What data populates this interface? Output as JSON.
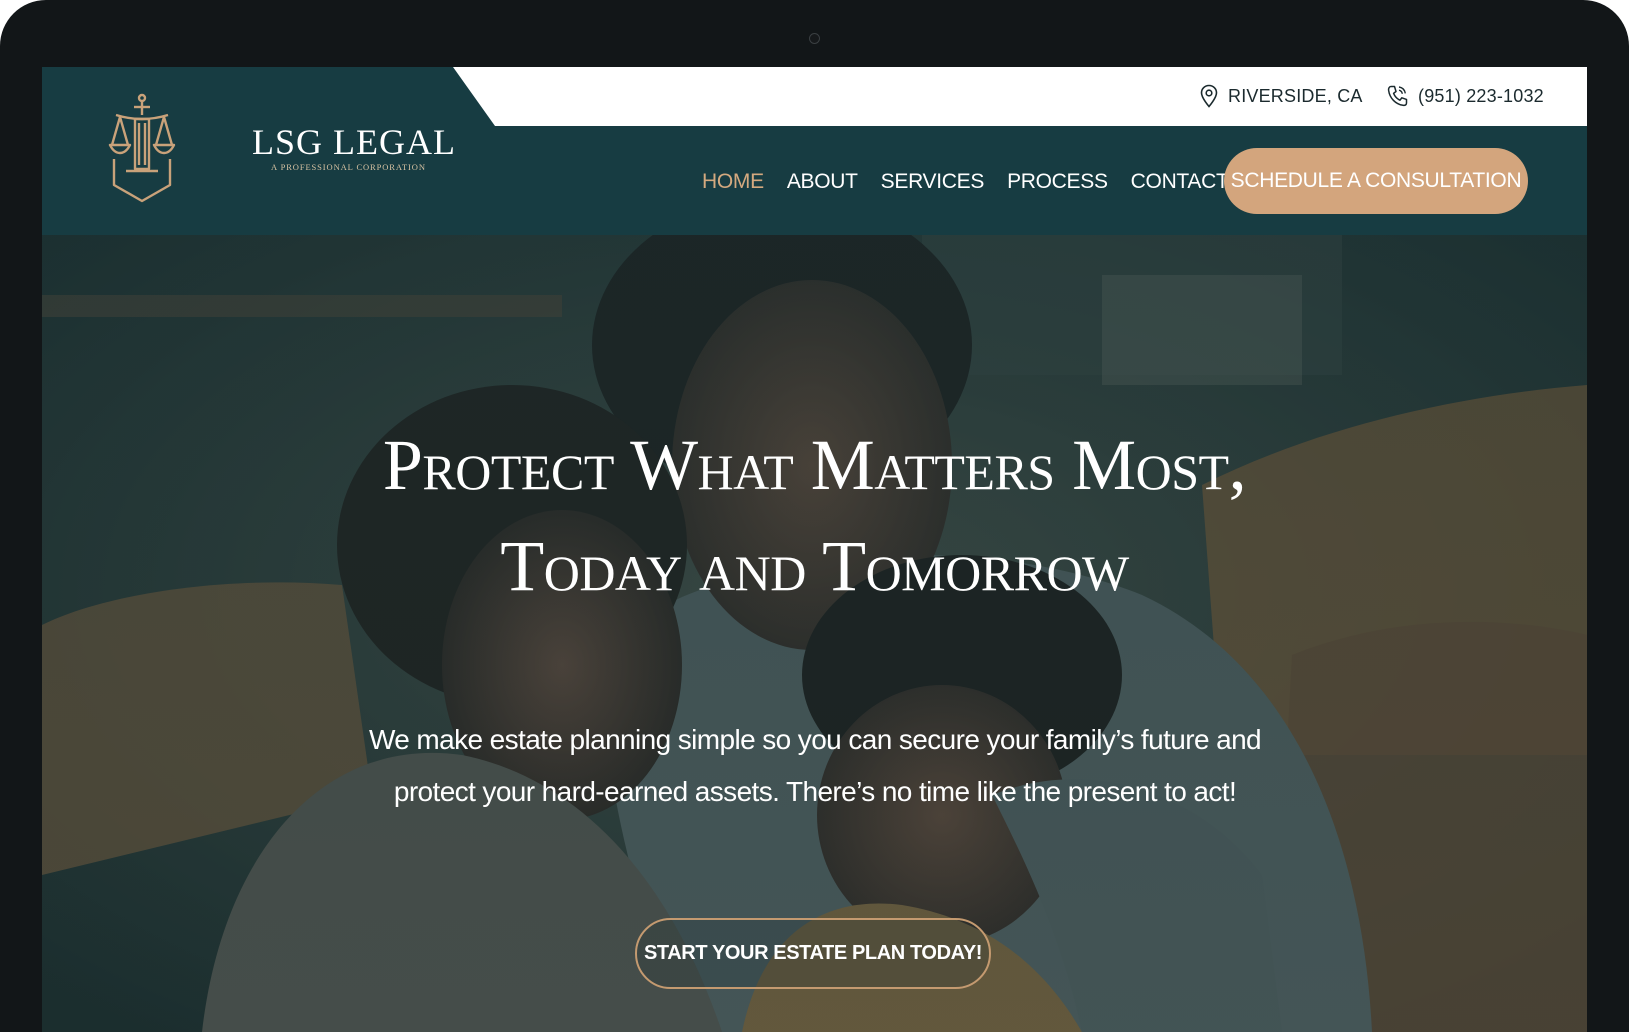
{
  "topbar": {
    "location": "RIVERSIDE, CA",
    "phone": "(951) 223-1032",
    "location_icon": "map-pin-icon",
    "phone_icon": "phone-icon"
  },
  "logo": {
    "title": "LSG LEGAL",
    "subtitle": "A PROFESSIONAL CORPORATION",
    "icon": "scales-of-justice-icon"
  },
  "nav": {
    "items": [
      {
        "label": "HOME",
        "active": true
      },
      {
        "label": "ABOUT",
        "active": false
      },
      {
        "label": "SERVICES",
        "active": false
      },
      {
        "label": "PROCESS",
        "active": false
      },
      {
        "label": "CONTACT US",
        "active": false
      }
    ],
    "cta_label": "SCHEDULE A CONSULTATION"
  },
  "hero": {
    "title_line1": "Protect What Matters Most,",
    "title_line2": "Today and Tomorrow",
    "text": "We make estate planning simple so you can secure your family’s future and protect your hard-earned assets. There’s no time like the present to act!",
    "cta_label": "START YOUR ESTATE PLAN TODAY!"
  },
  "colors": {
    "header_bg": "#173c42",
    "accent": "#d3a57d",
    "active_nav": "#d4a97f",
    "device_frame": "#121618"
  }
}
